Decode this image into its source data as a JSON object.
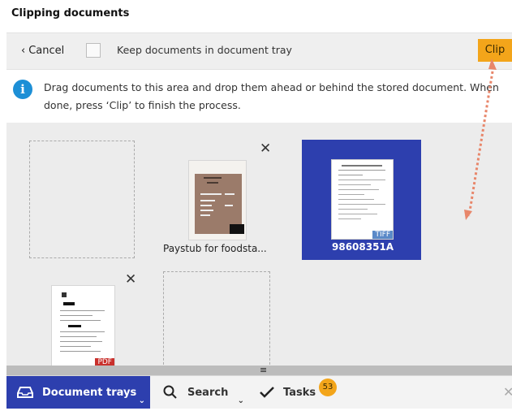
{
  "title": "Clipping documents",
  "toolbar": {
    "cancel_label": "Cancel",
    "keep_label": "Keep documents in document tray",
    "keep_checked": false,
    "clip_label": "Clip"
  },
  "info": {
    "line1": "Drag documents to this area and drop them ahead or behind the stored document. When",
    "line2": "done, press ‘Clip’ to finish the process."
  },
  "documents": [
    {
      "label": "Paystub for foodsta...",
      "badge": ""
    },
    {
      "label": "98608351A",
      "badge": "TIFF",
      "selected": true
    },
    {
      "label": "",
      "badge": "PDF"
    }
  ],
  "bottom_tabs": {
    "trays": "Document trays",
    "search": "Search",
    "tasks": "Tasks",
    "tasks_count": "53"
  },
  "colors": {
    "accent": "#f3a51a",
    "selected": "#2d3fae",
    "info": "#1d8fd6",
    "annotation_arrow": "#e8866a"
  },
  "icons": [
    "chevron-left-icon",
    "info-icon",
    "close-icon",
    "tray-icon",
    "search-icon",
    "checkmark-icon",
    "chevron-down-icon",
    "grip-icon"
  ]
}
